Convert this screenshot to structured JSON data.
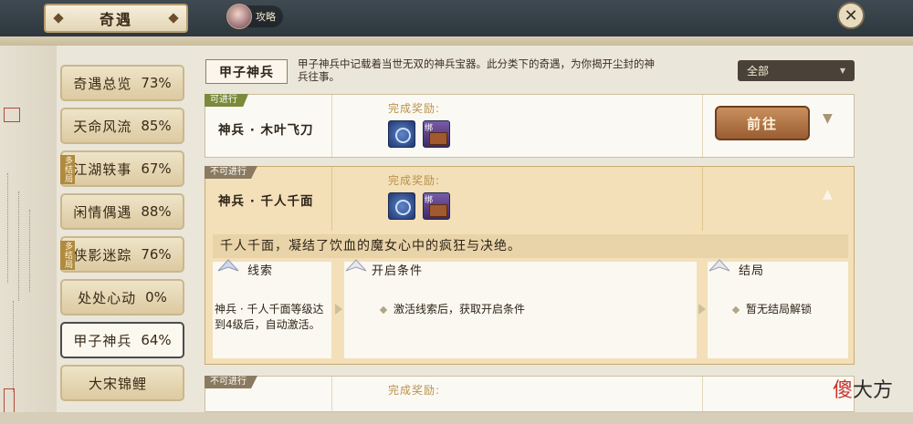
{
  "header": {
    "title": "奇遇",
    "guide_label": "攻略"
  },
  "sidebar": {
    "items": [
      {
        "label": "奇遇总览",
        "percent": "73%",
        "badge": ""
      },
      {
        "label": "天命风流",
        "percent": "85%",
        "badge": ""
      },
      {
        "label": "江湖轶事",
        "percent": "67%",
        "badge": "多结局"
      },
      {
        "label": "闲情偶遇",
        "percent": "88%",
        "badge": ""
      },
      {
        "label": "侠影迷踪",
        "percent": "76%",
        "badge": "多结局"
      },
      {
        "label": "处处心动",
        "percent": "0%",
        "badge": ""
      },
      {
        "label": "甲子神兵",
        "percent": "64%",
        "badge": ""
      },
      {
        "label": "大宋锦鲤",
        "percent": "",
        "badge": ""
      }
    ],
    "active_index": 6
  },
  "category": {
    "title": "甲子神兵",
    "description": "甲子神兵中记载着当世无双的神兵宝器。此分类下的奇遇，为你揭开尘封的神兵往事。"
  },
  "filter": {
    "selected": "全部"
  },
  "quests": [
    {
      "status": "可进行",
      "name": "神兵 · 木叶飞刀",
      "reward_label": "完成奖励:",
      "bind_label": "绑",
      "go_button": "前往",
      "expanded": false
    },
    {
      "status": "不可进行",
      "name": "神兵 · 千人千面",
      "reward_label": "完成奖励:",
      "bind_label": "绑",
      "expanded": true,
      "description": "千人千面，凝结了饮血的魔女心中的疯狂与决绝。",
      "clue": {
        "heading": "线索",
        "text": "神兵 · 千人千面等级达到4级后，自动激活。"
      },
      "condition": {
        "heading": "开启条件",
        "text": "激活线索后，获取开启条件"
      },
      "ending": {
        "heading": "结局",
        "text": "暂无结局解锁"
      }
    },
    {
      "status": "不可进行",
      "reward_label": "完成奖励:"
    }
  ],
  "icons": {
    "close": "close-icon",
    "dropdown_arrow": "triangle-down-icon",
    "expand": "chevron-down-icon",
    "collapse": "chevron-up-icon"
  },
  "watermark": {
    "ch1": "傻",
    "rest": "大方"
  }
}
